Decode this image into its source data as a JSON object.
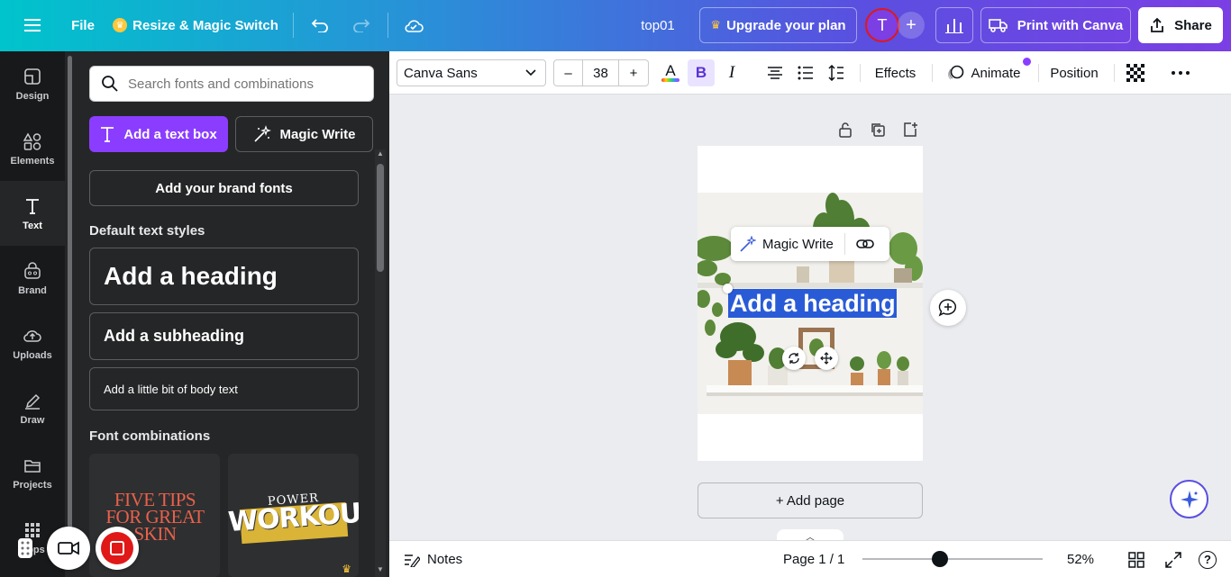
{
  "header": {
    "file_label": "File",
    "resize_label": "Resize & Magic Switch",
    "doc_title": "top01",
    "upgrade_label": "Upgrade your plan",
    "avatar_initial": "T",
    "print_label": "Print with Canva",
    "share_label": "Share"
  },
  "rail": {
    "items": [
      {
        "label": "Design",
        "icon": "design-icon"
      },
      {
        "label": "Elements",
        "icon": "elements-icon"
      },
      {
        "label": "Text",
        "icon": "text-icon"
      },
      {
        "label": "Brand",
        "icon": "brand-icon"
      },
      {
        "label": "Uploads",
        "icon": "uploads-icon"
      },
      {
        "label": "Draw",
        "icon": "draw-icon"
      },
      {
        "label": "Projects",
        "icon": "projects-icon"
      },
      {
        "label": "Apps",
        "icon": "apps-icon"
      }
    ],
    "active": "Text"
  },
  "panel": {
    "search_placeholder": "Search fonts and combinations",
    "add_text_box": "Add a text box",
    "magic_write": "Magic Write",
    "brand_fonts": "Add your brand fonts",
    "default_styles_title": "Default text styles",
    "heading": "Add a heading",
    "subheading": "Add a subheading",
    "body": "Add a little bit of body text",
    "combos_title": "Font combinations",
    "combo1": "FIVE TIPS FOR GREAT SKIN",
    "combo2_top": "POWER",
    "combo2_main": "WORKOUT"
  },
  "toolbar": {
    "font": "Canva Sans",
    "size": "38",
    "minus": "–",
    "plus": "+",
    "effects": "Effects",
    "animate": "Animate",
    "position": "Position"
  },
  "canvas": {
    "floating_magic_write": "Magic Write",
    "heading_text": "Add a heading",
    "add_page": "+ Add page"
  },
  "bottombar": {
    "notes": "Notes",
    "page_indicator": "Page 1 / 1",
    "zoom": "52%",
    "zoom_value": 52,
    "help": "?"
  },
  "colors": {
    "accent": "#8b3dff",
    "selection": "#2a5bd7",
    "rail_bg": "#18191b",
    "panel_bg": "#252627"
  }
}
